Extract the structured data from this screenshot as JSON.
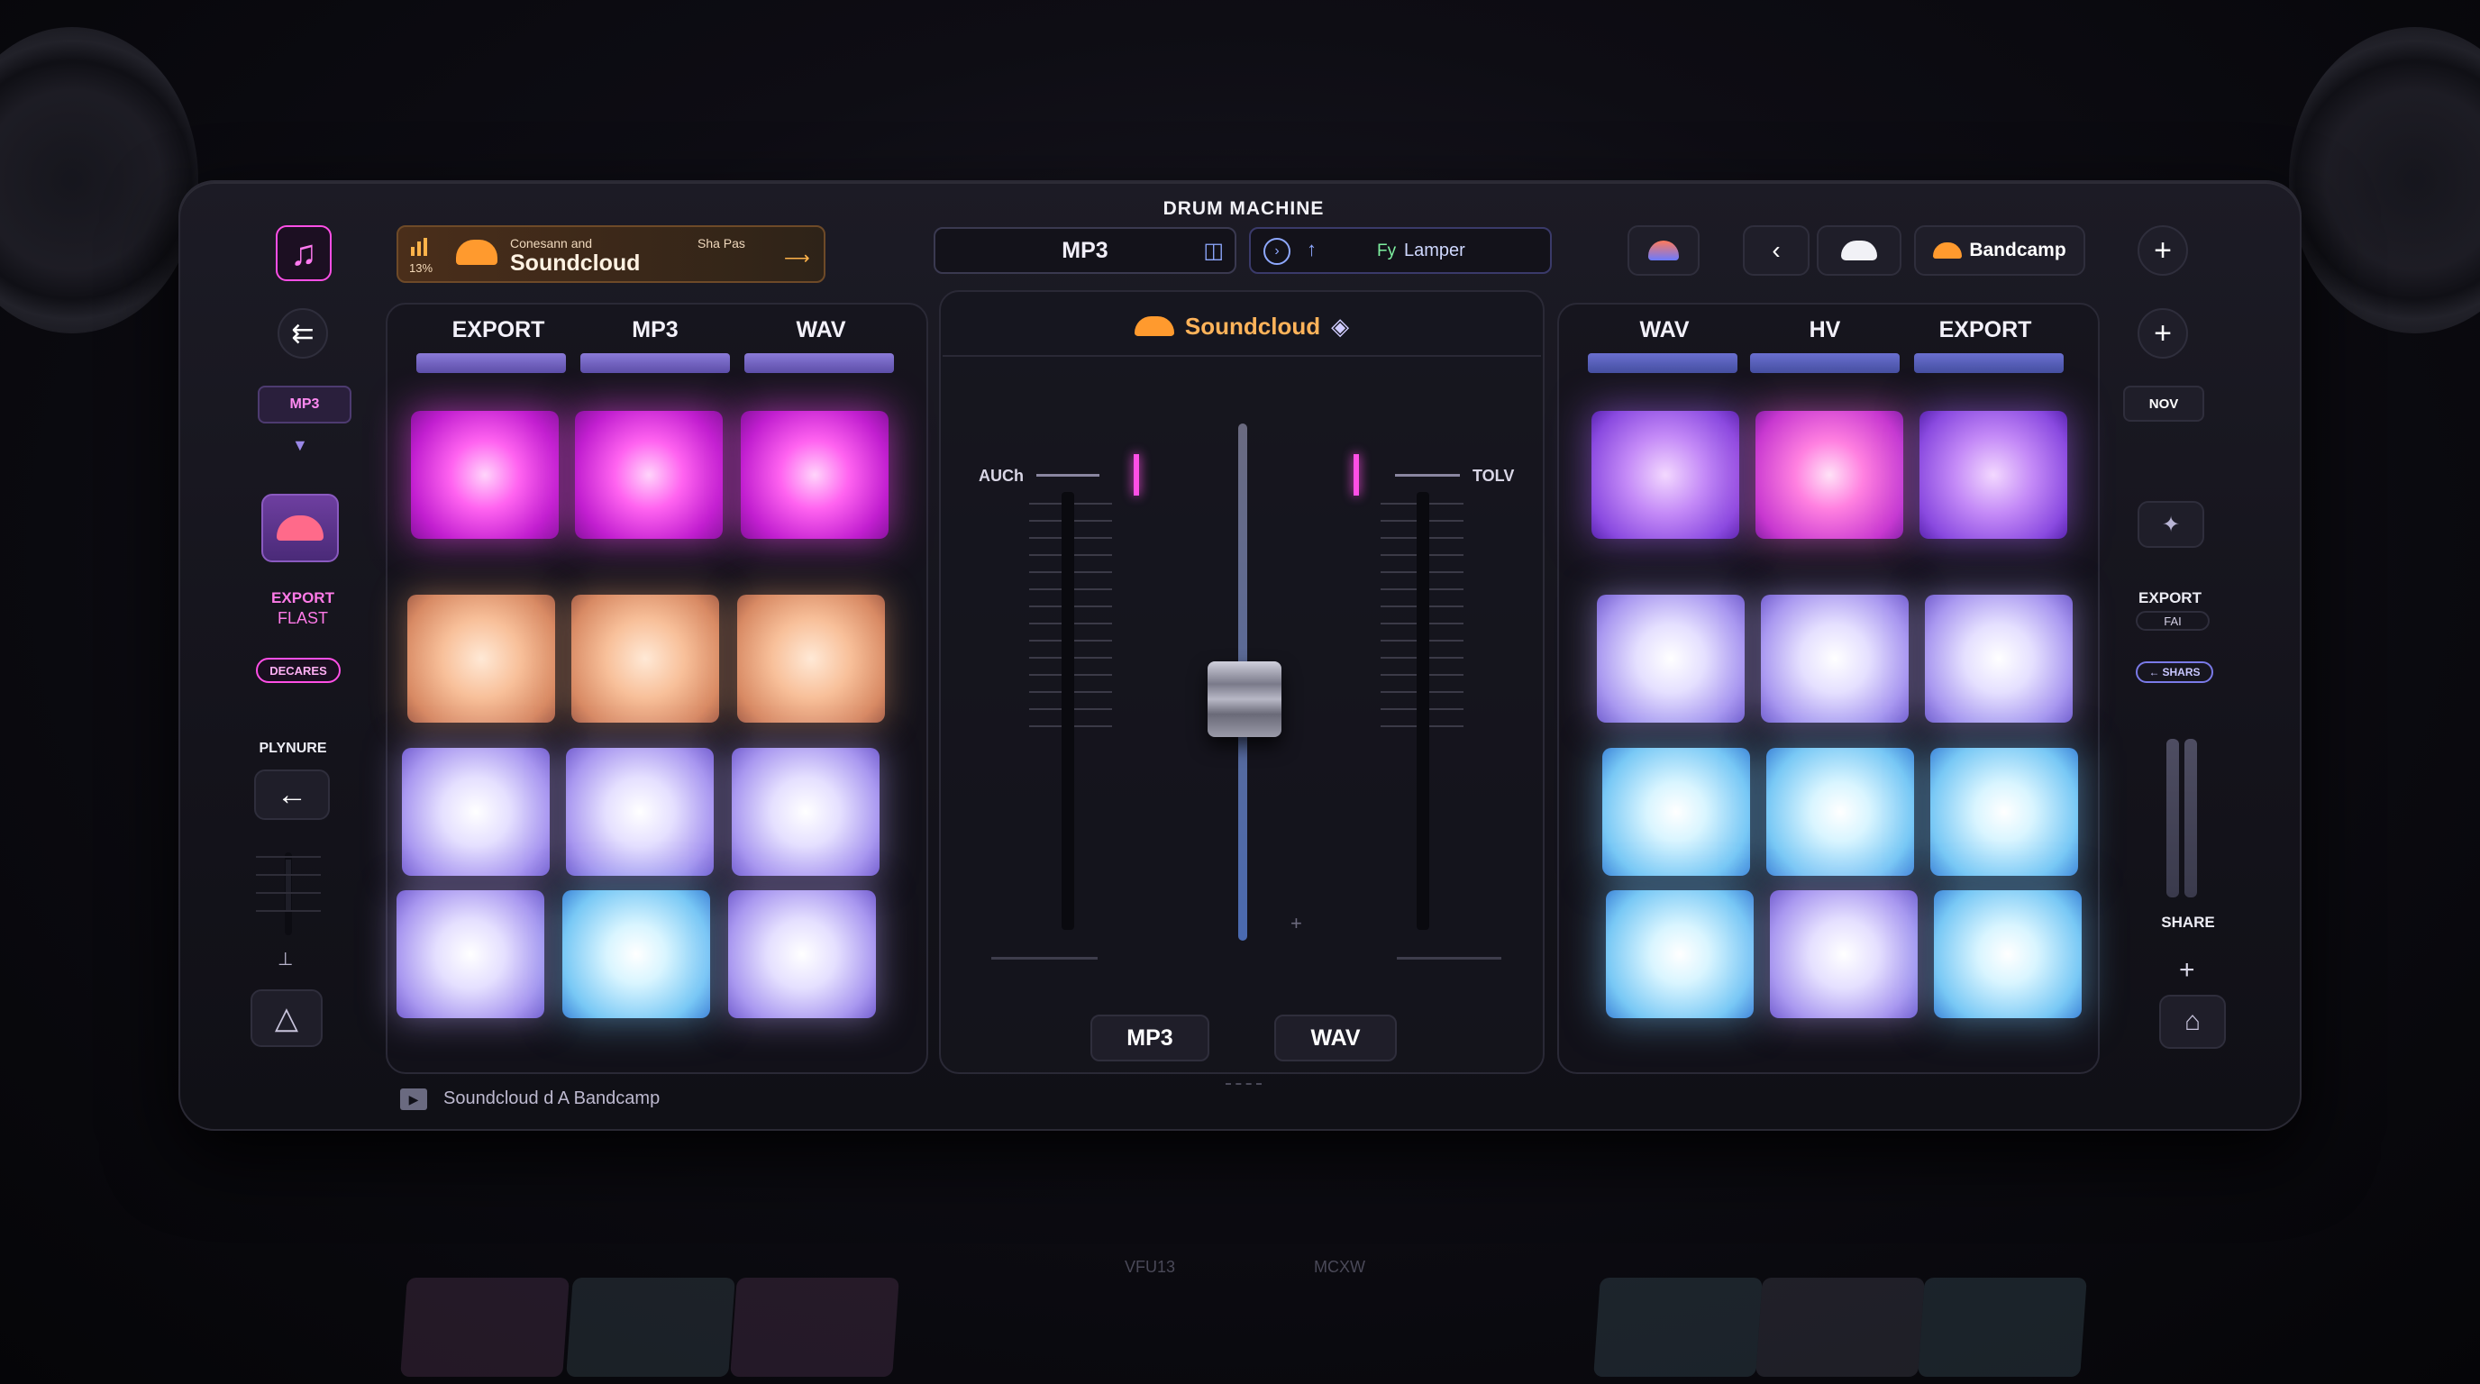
{
  "app": {
    "title": "DRUM MACHINE"
  },
  "header": {
    "source_card": {
      "level": "13%",
      "line1": "Conesann and",
      "line2": "Soundcloud",
      "tag": "Sha Pas"
    },
    "format_field": "MP3",
    "search_field": {
      "name": "Lamper",
      "prefix": "Fy"
    },
    "bandcamp_label": "Bandcamp"
  },
  "left_deck": {
    "tabs": [
      "EXPORT",
      "MP3",
      "WAV"
    ],
    "pads": [
      [
        "pk",
        "pk",
        "pk"
      ],
      [
        "or",
        "or",
        "or"
      ],
      [
        "lv",
        "lv",
        "lv"
      ],
      [
        "lv",
        "cy",
        "lv"
      ]
    ]
  },
  "right_deck": {
    "tabs": [
      "WAV",
      "HV",
      "EXPORT"
    ],
    "pads": [
      [
        "vi",
        "mg",
        "vi"
      ],
      [
        "lv",
        "lv",
        "lv"
      ],
      [
        "cy",
        "cy",
        "cy"
      ],
      [
        "cy",
        "lv",
        "cy"
      ]
    ]
  },
  "left_sidebar": {
    "format_badge": "MP3",
    "export_label": "EXPORT",
    "export_sub": "FLAST",
    "declares_chip": "DECARES",
    "play_label": "PLYNURE"
  },
  "right_sidebar": {
    "nov_badge": "NOV",
    "export_label": "EXPORT",
    "export_sub": "FAI",
    "share_chip": "SHARS",
    "share_label": "SHARE"
  },
  "mixer": {
    "brand": "Soundcloud",
    "left_channel": "AUCh",
    "right_channel": "TOLV",
    "crossfader_level": 0.62,
    "left_button": "MP3",
    "right_button": "WAV"
  },
  "footer": {
    "status": "Soundcloud d A Bandcamp"
  },
  "reflection": {
    "left": "VFU13",
    "right": "MCXW"
  },
  "colors": {
    "accent_pink": "#ff4fe6",
    "soundcloud_orange": "#ff9a2e",
    "frame": "#14131b"
  }
}
